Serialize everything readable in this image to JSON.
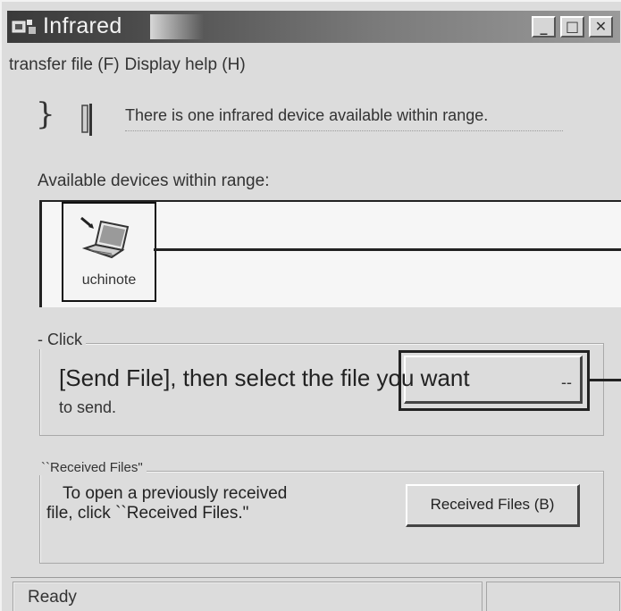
{
  "window": {
    "title": "Infrared"
  },
  "title_buttons": {
    "minimize": "_",
    "maximize": "□",
    "close": "✕"
  },
  "menu": {
    "items": [
      "transfer file (F)",
      "Display help (H)"
    ]
  },
  "status": {
    "message": "There is one infrared device available within range."
  },
  "devices": {
    "label": "Available devices within range:",
    "items": [
      {
        "name": "uchinote",
        "icon": "laptop-icon"
      }
    ]
  },
  "send_group": {
    "legend": "- Click",
    "text_main": "[Send File], then select the file you want",
    "text_cont": "to send.",
    "button_mark": "--"
  },
  "received_group": {
    "legend": "``Received Files\"",
    "text_line1": "To open a previously received",
    "text_line2": "file, click ``Received Files.\"",
    "button_label": "Received Files (B)"
  },
  "statusbar": {
    "text": "Ready"
  },
  "colors": {
    "titlebar_dark": "#3a3a3a",
    "window_face": "#dcdcdc",
    "list_bg": "#f6f6f6"
  }
}
